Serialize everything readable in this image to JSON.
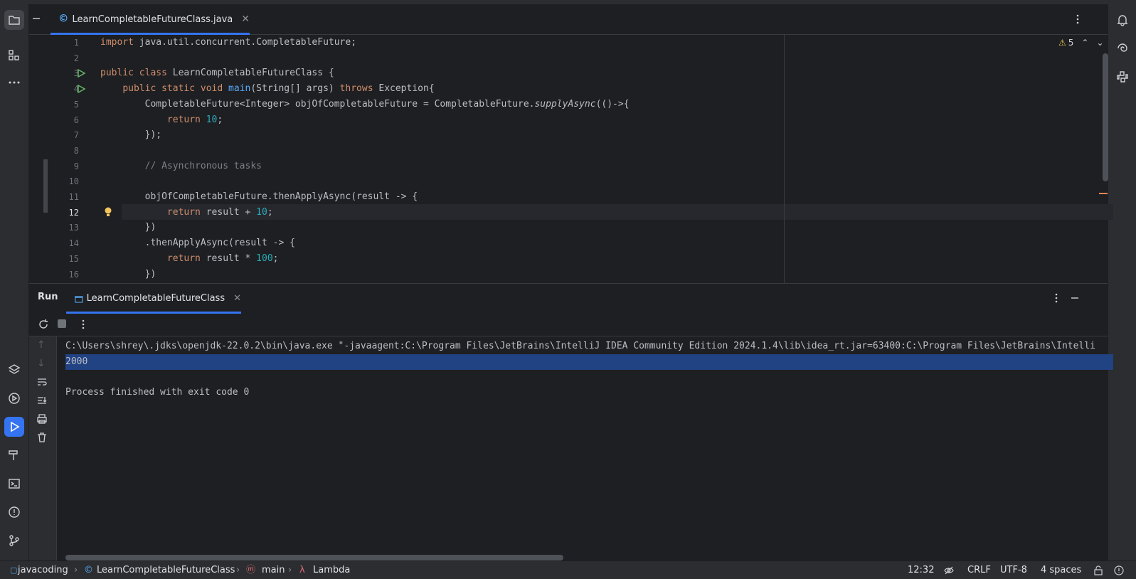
{
  "editor": {
    "tab_label": "LearnCompletableFutureClass.java",
    "warnings_count": "5",
    "lines": [
      {
        "n": "1",
        "html": "<span class='kw'>import</span> java.util.concurrent.CompletableFuture;"
      },
      {
        "n": "2",
        "html": ""
      },
      {
        "n": "3",
        "html": "<span class='kw'>public class</span> LearnCompletableFutureClass {"
      },
      {
        "n": "4",
        "html": "    <span class='kw'>public static void</span> <span class='fn'>main</span>(String[] args) <span class='kw'>throws</span> Exception{"
      },
      {
        "n": "5",
        "html": "        CompletableFuture&lt;Integer&gt; objOfCompletableFuture = CompletableFuture.<span class='it'>supplyAsync</span>(()-&gt;{"
      },
      {
        "n": "6",
        "html": "            <span class='kw'>return</span> <span class='num'>10</span>;"
      },
      {
        "n": "7",
        "html": "        });"
      },
      {
        "n": "8",
        "html": ""
      },
      {
        "n": "9",
        "html": "        <span class='cm'>// Asynchronous tasks</span>"
      },
      {
        "n": "10",
        "html": ""
      },
      {
        "n": "11",
        "html": "        objOfCompletableFuture.thenApplyAsync(result -&gt; {"
      },
      {
        "n": "12",
        "html": "            <span class='kw'>return</span> result + <span class='num'>10</span>;"
      },
      {
        "n": "13",
        "html": "        })"
      },
      {
        "n": "14",
        "html": "        .thenApplyAsync(result -&gt; {"
      },
      {
        "n": "15",
        "html": "            <span class='kw'>return</span> result * <span class='num'>100</span>;"
      },
      {
        "n": "16",
        "html": "        })"
      }
    ]
  },
  "run": {
    "title": "Run",
    "tab_label": "LearnCompletableFutureClass",
    "console": [
      "C:\\Users\\shrey\\.jdks\\openjdk-22.0.2\\bin\\java.exe \"-javaagent:C:\\Program Files\\JetBrains\\IntelliJ IDEA Community Edition 2024.1.4\\lib\\idea_rt.jar=63400:C:\\Program Files\\JetBrains\\Intelli",
      "2000",
      "",
      "Process finished with exit code 0"
    ]
  },
  "statusbar": {
    "project": "javacoding",
    "class": "LearnCompletableFutureClass",
    "method": "main",
    "lambda": "Lambda",
    "position": "12:32",
    "line_sep": "CRLF",
    "encoding": "UTF-8",
    "indent": "4 spaces"
  },
  "colors": {
    "accent": "#3574f0",
    "selection": "#214283"
  }
}
